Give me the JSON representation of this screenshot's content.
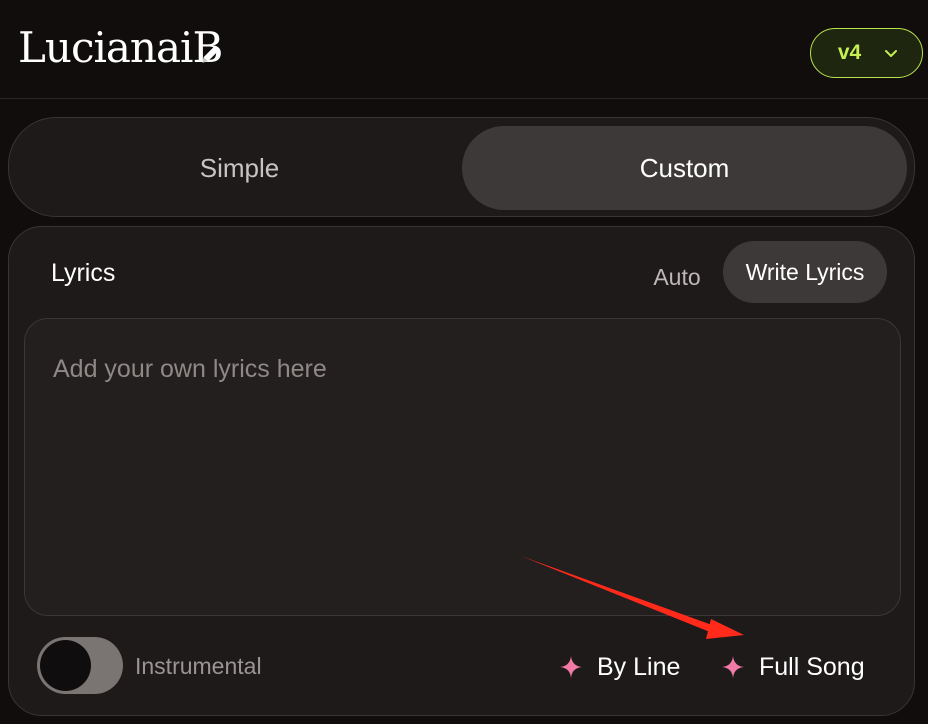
{
  "header": {
    "title": "LucianaiB",
    "edit_icon": "pencil-icon",
    "version": {
      "label": "v4",
      "icon": "chevron-down-icon",
      "accent": "#c5ef52"
    }
  },
  "mode": {
    "tabs": [
      {
        "label": "Simple",
        "selected": false
      },
      {
        "label": "Custom",
        "selected": true
      }
    ]
  },
  "lyrics": {
    "heading": "Lyrics",
    "options": [
      {
        "label": "Auto",
        "selected": false
      },
      {
        "label": "Write Lyrics",
        "selected": true
      }
    ],
    "input": {
      "value": "",
      "placeholder": "Add your own lyrics here"
    },
    "instrumental": {
      "label": "Instrumental",
      "on": false
    },
    "generate": [
      {
        "label": "By Line",
        "icon": "sparkle-icon"
      },
      {
        "label": "Full Song",
        "icon": "sparkle-icon"
      }
    ]
  },
  "colors": {
    "background": "#110d0d",
    "panel": "#1e1a1a",
    "selected": "#3d3938",
    "sparkle": "#f27aa6",
    "annotation_arrow": "#ff2a1a"
  }
}
